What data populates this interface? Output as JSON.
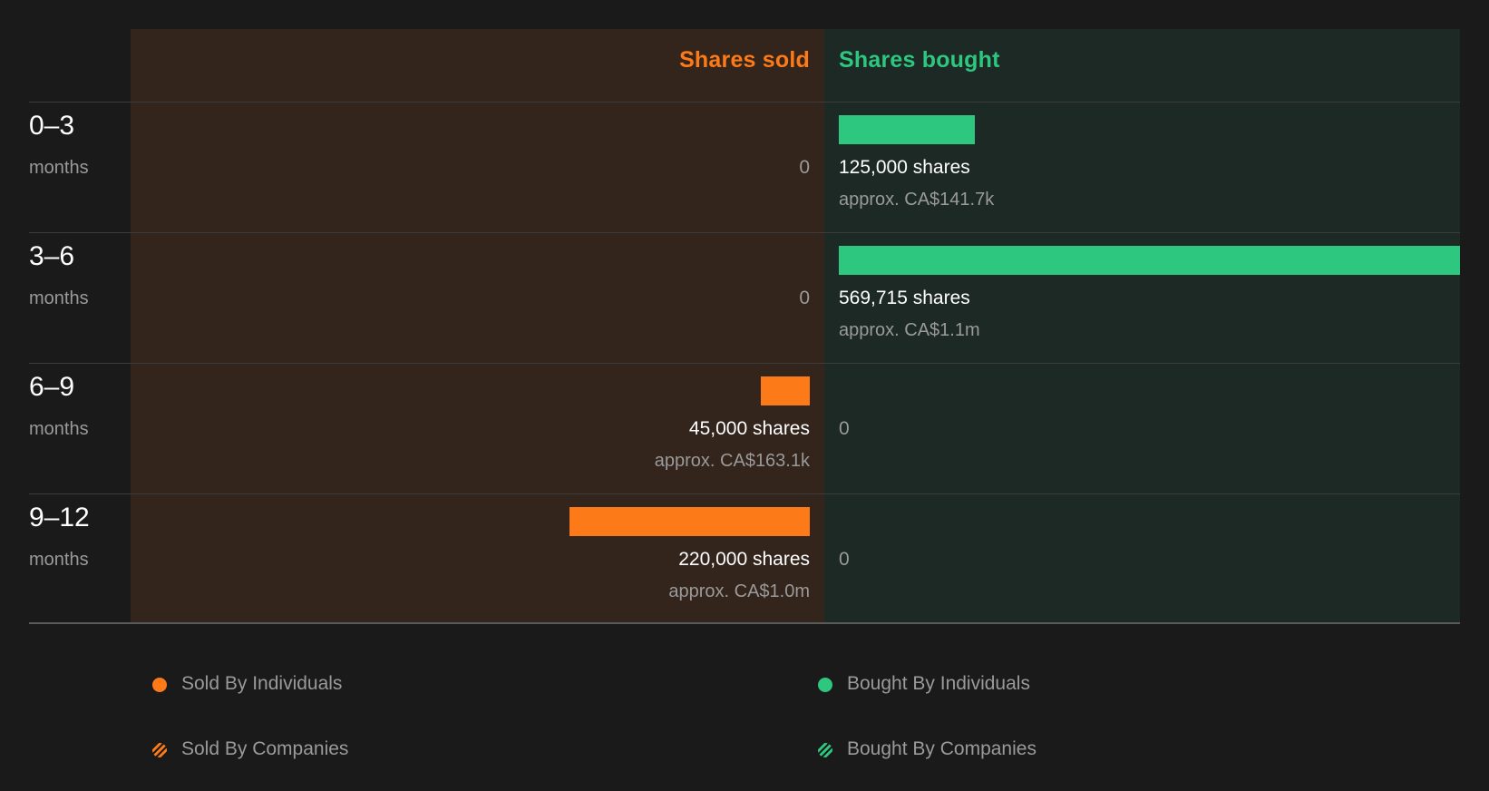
{
  "headers": {
    "sold": "Shares sold",
    "bought": "Shares bought"
  },
  "colors": {
    "sold": "#fd7a18",
    "bought": "#2ec77f",
    "sold_bg": "#33241c",
    "bought_bg": "#1c2924",
    "background": "#1a1a1a"
  },
  "chart_data": {
    "type": "bar",
    "orientation": "horizontal-diverging",
    "categories": [
      "0–3",
      "3–6",
      "6–9",
      "9–12"
    ],
    "category_unit": "months",
    "series": [
      {
        "name": "Shares sold",
        "values": [
          0,
          0,
          45000,
          220000
        ],
        "shares_labels": [
          "0",
          "0",
          "45,000 shares",
          "220,000 shares"
        ],
        "approx_labels": [
          "",
          "",
          "approx. CA$163.1k",
          "approx. CA$1.0m"
        ]
      },
      {
        "name": "Shares bought",
        "values": [
          125000,
          569715,
          0,
          0
        ],
        "shares_labels": [
          "125,000 shares",
          "569,715 shares",
          "0",
          "0"
        ],
        "approx_labels": [
          "approx. CA$141.7k",
          "approx. CA$1.1m",
          "",
          ""
        ]
      }
    ],
    "legend": [
      {
        "label": "Sold By Individuals",
        "color": "#fd7a18",
        "style": "solid"
      },
      {
        "label": "Bought By Individuals",
        "color": "#2ec77f",
        "style": "solid"
      },
      {
        "label": "Sold By Companies",
        "color": "#fd7a18",
        "style": "hatched"
      },
      {
        "label": "Bought By Companies",
        "color": "#2ec77f",
        "style": "hatched"
      }
    ],
    "legend_placement": "bottom"
  }
}
